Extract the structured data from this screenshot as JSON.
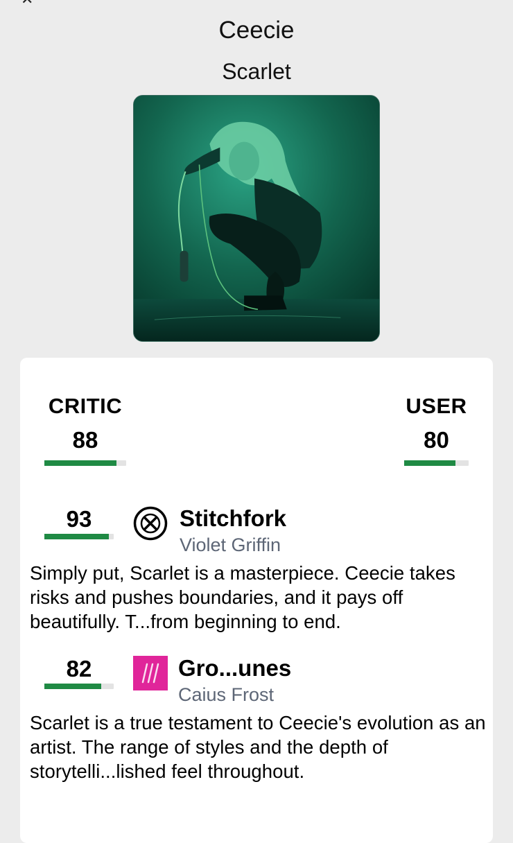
{
  "header": {
    "artist": "Ceecie",
    "album": "Scarlet"
  },
  "cover": {
    "theme_color": "#0f5a49"
  },
  "scores": {
    "critic": {
      "label": "CRITIC",
      "value": "88",
      "fill_percent": 88
    },
    "user": {
      "label": "USER",
      "value": "80",
      "fill_percent": 80
    }
  },
  "reviews": [
    {
      "score": "93",
      "fill_percent": 93,
      "publication": "Stitchfork",
      "logo_icon": "stitchfork-x-logo",
      "critic": "Violet Griffin",
      "text": "Simply put, Scarlet  is a masterpiece. Ceecie takes risks and pushes boundaries, and it pays off beautifully. T...from beginning to end."
    },
    {
      "score": "82",
      "fill_percent": 82,
      "publication": "Gro...unes",
      "logo_icon": "pink-square-logo",
      "logo_color": "#e0259a",
      "critic": "Caius Frost",
      "text": "Scarlet  is a true testament to Ceecie's evolution as an artist. The range of styles and the depth of storytelli...lished feel throughout."
    }
  ],
  "colors": {
    "bar_fill": "#1f8a44",
    "bar_track": "#e3e3e3",
    "critic_name": "#5d6676"
  }
}
